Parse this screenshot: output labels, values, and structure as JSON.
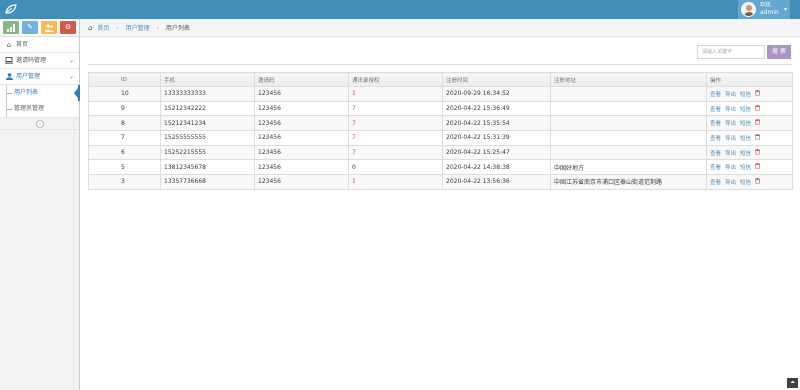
{
  "user": {
    "welcome": "欢迎,",
    "name": "admin"
  },
  "sidebar": {
    "items": [
      {
        "label": "首页",
        "icon": "home-icon"
      },
      {
        "label": "邀请码管理",
        "icon": "laptop-icon"
      },
      {
        "label": "用户管理",
        "icon": "user-icon"
      }
    ],
    "sub_items": [
      {
        "label": "用户列表"
      },
      {
        "label": "管理员管理"
      }
    ]
  },
  "breadcrumb": {
    "home": "首页",
    "section": "用户管理",
    "current": "用户列表"
  },
  "search": {
    "placeholder": "请输入关键字",
    "button": "搜 索"
  },
  "table": {
    "headers": [
      "ID",
      "手机",
      "邀请码",
      "通讯录授权",
      "注册时间",
      "注册地址",
      "操作"
    ],
    "actions": {
      "view": "查看",
      "export": "导出",
      "sms": "短信"
    },
    "rows": [
      {
        "id": "10",
        "phone": "13333333333",
        "code": "123456",
        "auth": "1",
        "time": "2020-09-29 16:34:52",
        "addr": ""
      },
      {
        "id": "9",
        "phone": "15212342222",
        "code": "123456",
        "auth": "7",
        "time": "2020-04-22 15:36:49",
        "addr": ""
      },
      {
        "id": "8",
        "phone": "15212341234",
        "code": "123456",
        "auth": "7",
        "time": "2020-04-22 15:35:54",
        "addr": ""
      },
      {
        "id": "7",
        "phone": "15255555555",
        "code": "123456",
        "auth": "7",
        "time": "2020-04-22 15:31:39",
        "addr": ""
      },
      {
        "id": "6",
        "phone": "15252215555",
        "code": "123456",
        "auth": "7",
        "time": "2020-04-22 15:25:47",
        "addr": ""
      },
      {
        "id": "5",
        "phone": "13812345678",
        "code": "123456",
        "auth": "0",
        "time": "2020-04-22 14:38:38",
        "addr": "中国好地方"
      },
      {
        "id": "3",
        "phone": "13357736668",
        "code": "123456",
        "auth": "1",
        "time": "2020-04-22 13:56:36",
        "addr": "中国江苏省南京市浦口区泰山街道范荆路"
      }
    ]
  },
  "colors": {
    "navbar": "#438eb9",
    "accent": "#2b7dbc",
    "danger": "#d15b47",
    "search_button": "#a895c1"
  }
}
